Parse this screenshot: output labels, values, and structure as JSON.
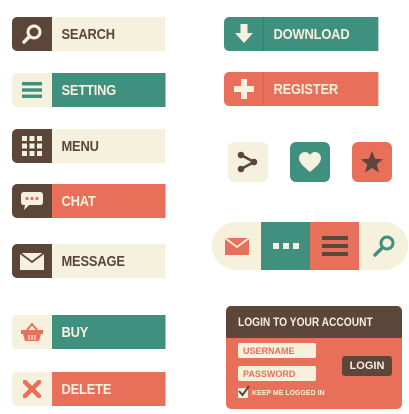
{
  "colors": {
    "brown": "#5c4639",
    "teal": "#40907f",
    "red": "#e8705a",
    "cream": "#f6f1dc"
  },
  "buttons": {
    "search": {
      "label": "SEARCH",
      "icon": "search-icon"
    },
    "setting": {
      "label": "SETTING",
      "icon": "hamburger-icon"
    },
    "menu": {
      "label": "MENU",
      "icon": "grid-icon"
    },
    "chat": {
      "label": "CHAT",
      "icon": "chat-bubble-icon"
    },
    "message": {
      "label": "MESSAGE",
      "icon": "envelope-icon"
    },
    "buy": {
      "label": "BUY",
      "icon": "basket-icon"
    },
    "delete": {
      "label": "DELETE",
      "icon": "close-icon"
    },
    "download": {
      "label": "DOWNLOAD",
      "icon": "download-arrow-icon"
    },
    "register": {
      "label": "REGISTER",
      "icon": "plus-icon"
    }
  },
  "icon_buttons": [
    "share-icon",
    "heart-icon",
    "star-icon"
  ],
  "pill_toolbar": [
    "envelope-icon",
    "ellipsis-icon",
    "hamburger-icon",
    "search-icon"
  ],
  "login": {
    "title": "LOGIN TO YOUR ACCOUNT",
    "username_placeholder": "USERNAME",
    "password_placeholder": "PASSWORD",
    "login_label": "LOGIN",
    "keep_logged_in": "KEEP ME LOGGED IN",
    "keep_logged_in_checked": true
  }
}
